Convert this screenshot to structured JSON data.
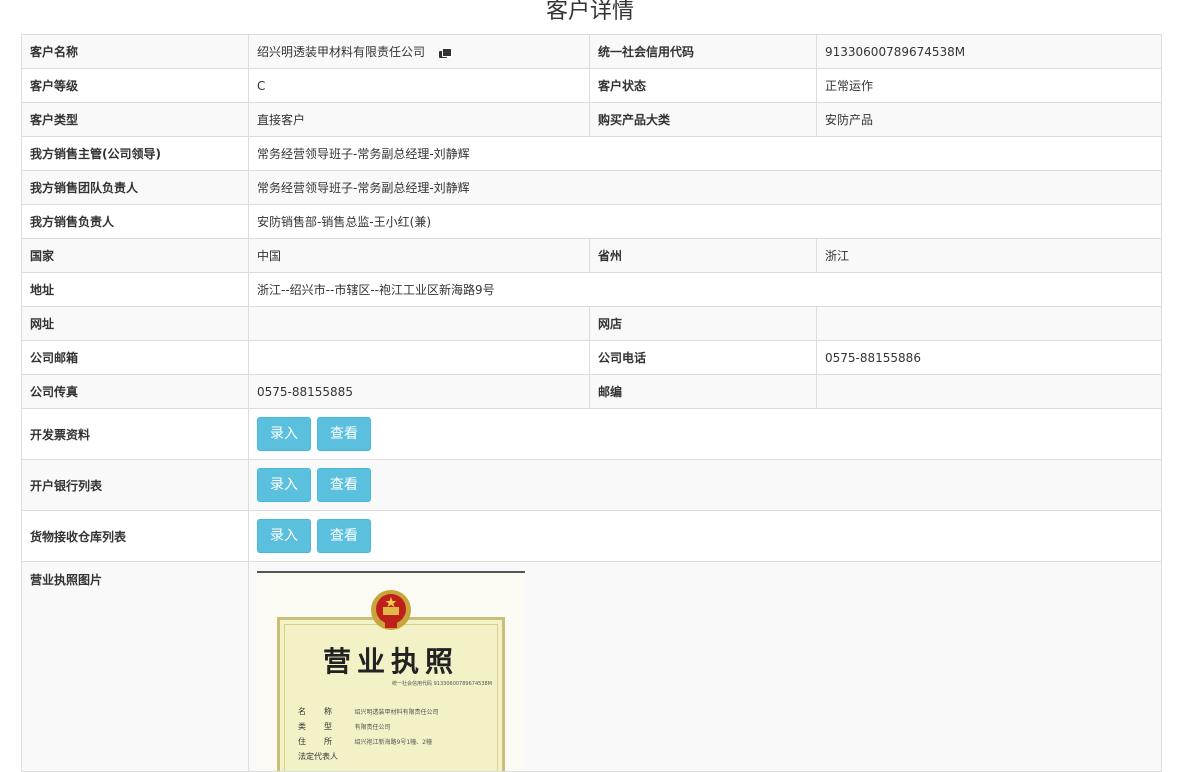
{
  "page": {
    "title": "客户详情"
  },
  "rows": {
    "customer_name": {
      "label": "客户名称",
      "value": "绍兴明透装甲材料有限责任公司"
    },
    "credit_code": {
      "label": "统一社会信用代码",
      "value": "91330600789674538M"
    },
    "customer_level": {
      "label": "客户等级",
      "value": "C"
    },
    "customer_status": {
      "label": "客户状态",
      "value": "正常运作"
    },
    "customer_type": {
      "label": "客户类型",
      "value": "直接客户"
    },
    "product_category": {
      "label": "购买产品大类",
      "value": "安防产品"
    },
    "sales_supervisor": {
      "label": "我方销售主管(公司领导)",
      "value": "常务经营领导班子-常务副总经理-刘静辉"
    },
    "sales_team_lead": {
      "label": "我方销售团队负责人",
      "value": "常务经营领导班子-常务副总经理-刘静辉"
    },
    "sales_owner": {
      "label": "我方销售负责人",
      "value": "安防销售部-销售总监-王小红(兼)"
    },
    "country": {
      "label": "国家",
      "value": "中国"
    },
    "province": {
      "label": "省州",
      "value": "浙江"
    },
    "address": {
      "label": "地址",
      "value": "浙江--绍兴市--市辖区--袍江工业区新海路9号"
    },
    "website": {
      "label": "网址",
      "value": ""
    },
    "online_store": {
      "label": "网店",
      "value": ""
    },
    "email": {
      "label": "公司邮箱",
      "value": ""
    },
    "phone": {
      "label": "公司电话",
      "value": "0575-88155886"
    },
    "fax": {
      "label": "公司传真",
      "value": "0575-88155885"
    },
    "postcode": {
      "label": "邮编",
      "value": ""
    },
    "invoice_info": {
      "label": "开发票资料"
    },
    "bank_accounts": {
      "label": "开户银行列表"
    },
    "warehouses": {
      "label": "货物接收仓库列表"
    },
    "license_image": {
      "label": "营业执照图片"
    }
  },
  "buttons": {
    "enter": "录入",
    "view": "查看"
  },
  "icons": {
    "copy": "copy-icon"
  },
  "license": {
    "title": "营业执照",
    "code_line": "统一社会信用代码 91330600789674538M",
    "fields": [
      {
        "key": "名称",
        "value": "绍兴明透装甲材料有限责任公司"
      },
      {
        "key": "类型",
        "value": "有限责任公司"
      },
      {
        "key": "住所",
        "value": "绍兴袍江新海路9号1幢、2幢"
      },
      {
        "key": "法定代表人",
        "value": ""
      }
    ]
  },
  "colors": {
    "button": "#5bc0de",
    "border": "#dddddd",
    "stripe": "#f9f9f9"
  }
}
